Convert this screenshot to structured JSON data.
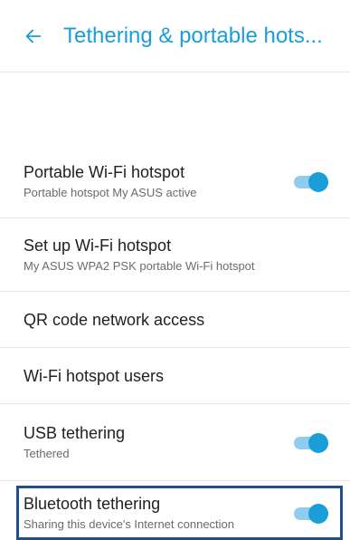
{
  "appbar": {
    "title": "Tethering & portable hots...",
    "back_icon": "arrow-left-icon"
  },
  "colors": {
    "accent": "#1a9ed8",
    "toggle_track": "#8fcdee",
    "highlight_border": "#1f4f8b"
  },
  "items": [
    {
      "title": "Portable Wi-Fi hotspot",
      "subtitle": "Portable hotspot My ASUS active",
      "toggle": "on"
    },
    {
      "title": "Set up Wi-Fi hotspot",
      "subtitle": "My ASUS WPA2 PSK portable Wi-Fi hotspot"
    },
    {
      "title": "QR code network access"
    },
    {
      "title": "Wi-Fi hotspot users"
    },
    {
      "title": "USB tethering",
      "subtitle": "Tethered",
      "toggle": "on"
    },
    {
      "title": "Bluetooth tethering",
      "subtitle": "Sharing this device's Internet connection",
      "toggle": "on",
      "highlighted": true
    }
  ]
}
